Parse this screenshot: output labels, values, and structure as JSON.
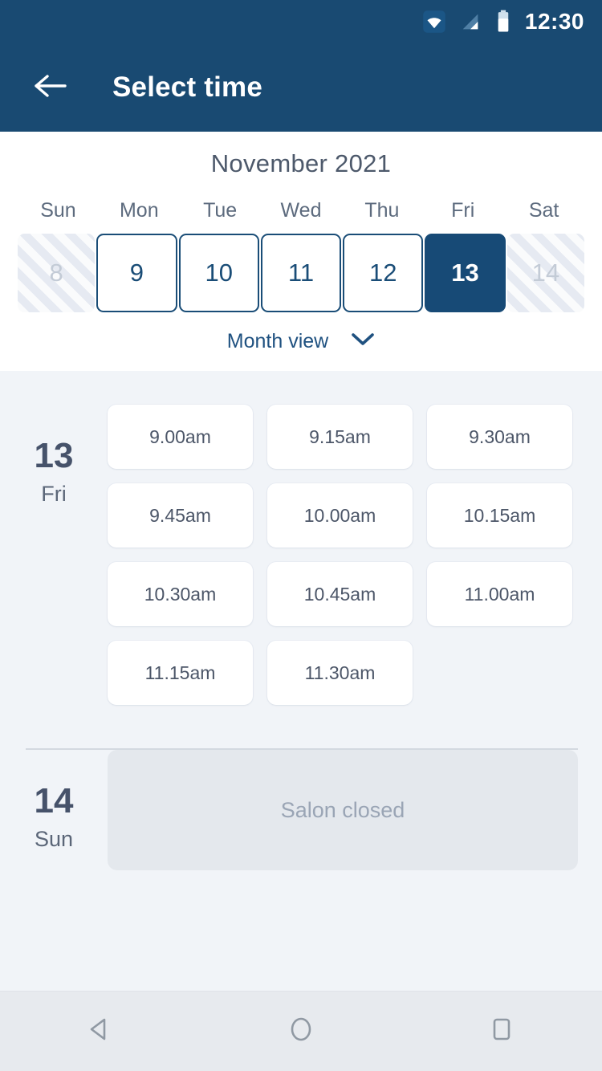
{
  "status_bar": {
    "clock": "12:30",
    "icons": [
      "wifi-icon",
      "signal-icon",
      "battery-icon"
    ]
  },
  "app_bar": {
    "back_icon": "back-arrow-icon",
    "title": "Select time",
    "background_color": "#194a72"
  },
  "calendar": {
    "month_title": "November 2021",
    "day_of_week_headers": [
      "Sun",
      "Mon",
      "Tue",
      "Wed",
      "Thu",
      "Fri",
      "Sat"
    ],
    "days": [
      {
        "number": "8",
        "state": "disabled"
      },
      {
        "number": "9",
        "state": "available"
      },
      {
        "number": "10",
        "state": "available"
      },
      {
        "number": "11",
        "state": "available"
      },
      {
        "number": "12",
        "state": "available"
      },
      {
        "number": "13",
        "state": "selected"
      },
      {
        "number": "14",
        "state": "disabled"
      }
    ],
    "month_view_label": "Month view",
    "month_view_chevron": "chevron-down-icon",
    "selected_color": "#174a76",
    "available_border_color": "#1a4d77"
  },
  "day_sections": [
    {
      "date_number": "13",
      "date_weekday": "Fri",
      "slots": [
        "9.00am",
        "9.15am",
        "9.30am",
        "9.45am",
        "10.00am",
        "10.15am",
        "10.30am",
        "10.45am",
        "11.00am",
        "11.15am",
        "11.30am"
      ]
    },
    {
      "date_number": "14",
      "date_weekday": "Sun",
      "closed_message": "Salon closed"
    }
  ],
  "nav_bar": {
    "buttons": [
      "back-triangle-icon",
      "home-circle-icon",
      "recents-square-icon"
    ]
  }
}
